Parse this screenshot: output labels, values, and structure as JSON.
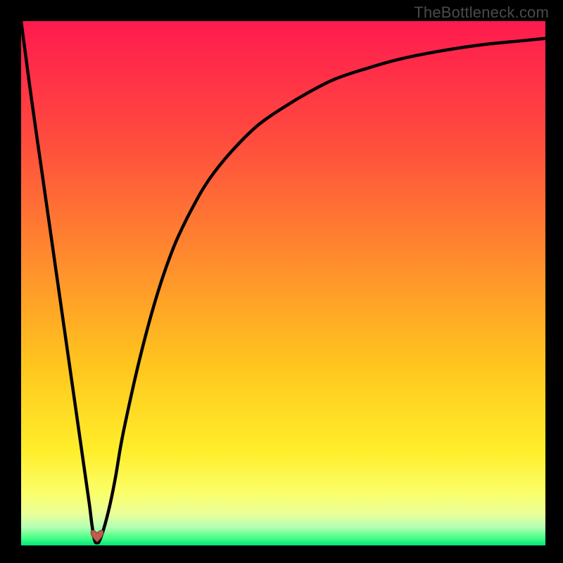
{
  "watermark": "TheBottleneck.com",
  "colors": {
    "bg": "#000000",
    "curve": "#000000",
    "heart": "#c15a4f",
    "gradient_stops": [
      {
        "offset": 0.0,
        "color": "#ff1a4f"
      },
      {
        "offset": 0.22,
        "color": "#ff4a3e"
      },
      {
        "offset": 0.45,
        "color": "#ff8a2e"
      },
      {
        "offset": 0.65,
        "color": "#ffc41e"
      },
      {
        "offset": 0.82,
        "color": "#ffee2a"
      },
      {
        "offset": 0.9,
        "color": "#fbff6a"
      },
      {
        "offset": 0.94,
        "color": "#eaff9a"
      },
      {
        "offset": 0.965,
        "color": "#b4ffb4"
      },
      {
        "offset": 0.985,
        "color": "#4cff88"
      },
      {
        "offset": 1.0,
        "color": "#00e878"
      }
    ]
  },
  "chart_data": {
    "type": "line",
    "title": "",
    "xlabel": "",
    "ylabel": "",
    "xlim": [
      0,
      100
    ],
    "ylim": [
      0,
      100
    ],
    "x": [
      0,
      2,
      4,
      6,
      8,
      10,
      11,
      12,
      13,
      13.5,
      14,
      14.5,
      15,
      16,
      17,
      18,
      19,
      20,
      22,
      24,
      26,
      28,
      30,
      33,
      36,
      40,
      45,
      50,
      55,
      60,
      66,
      72,
      80,
      88,
      95,
      100
    ],
    "values": [
      100,
      85,
      71,
      57,
      43,
      29,
      22,
      15,
      8,
      4,
      1,
      0.5,
      1,
      4,
      8,
      13,
      19,
      24,
      33,
      41,
      48,
      54,
      59,
      65,
      70,
      75,
      80,
      83.5,
      86.5,
      89,
      91,
      92.7,
      94.3,
      95.5,
      96.2,
      96.7
    ],
    "marker": {
      "type": "heart",
      "x": 14.5,
      "y": 0.5
    },
    "note": "Background is a red→yellow→green vertical gradient; curve values are estimated from pixel positions."
  }
}
